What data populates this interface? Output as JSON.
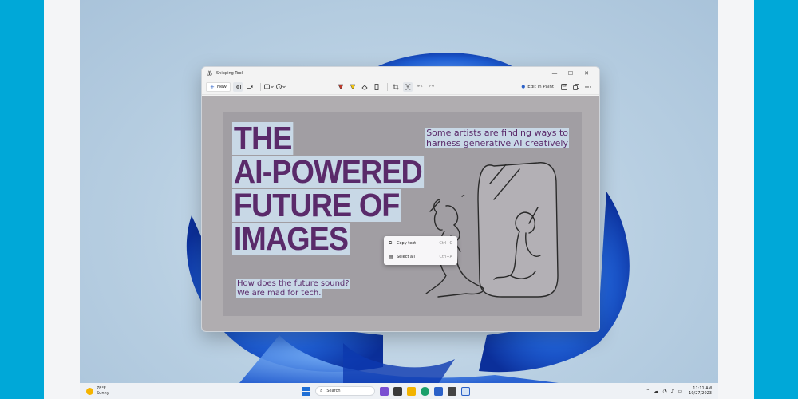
{
  "window": {
    "title": "Snipping Tool",
    "controls": {
      "minimize": "—",
      "maximize": "☐",
      "close": "✕"
    }
  },
  "toolbar": {
    "new_label": "New",
    "new_icon": "+",
    "edit_in_paint_label": "Edit in Paint"
  },
  "screenshot": {
    "headline_lines": [
      "THE",
      "AI-POWERED",
      "FUTURE OF",
      "IMAGES"
    ],
    "subhead_lines": [
      "Some artists are finding ways to",
      "harness generative AI creatively"
    ],
    "footer_lines": [
      "How does the future sound?",
      "We are mad for tech."
    ],
    "text_color": "#5a2a6a",
    "highlight_color": "#c8d8e6",
    "background_color": "#a19ea3"
  },
  "context_menu": {
    "items": [
      {
        "label": "Copy text",
        "shortcut": "Ctrl+C",
        "icon": "copy-text-icon"
      },
      {
        "label": "Select all",
        "shortcut": "Ctrl+A",
        "icon": "select-all-icon"
      }
    ]
  },
  "taskbar": {
    "weather_temp": "78°F",
    "weather_desc": "Sunny",
    "search_placeholder": "Search",
    "time": "11:11 AM",
    "date": "10/27/2023"
  },
  "colors": {
    "accent": "#2b61c8",
    "frame": "#00a8d8",
    "bloom": "#1f5fd6"
  }
}
